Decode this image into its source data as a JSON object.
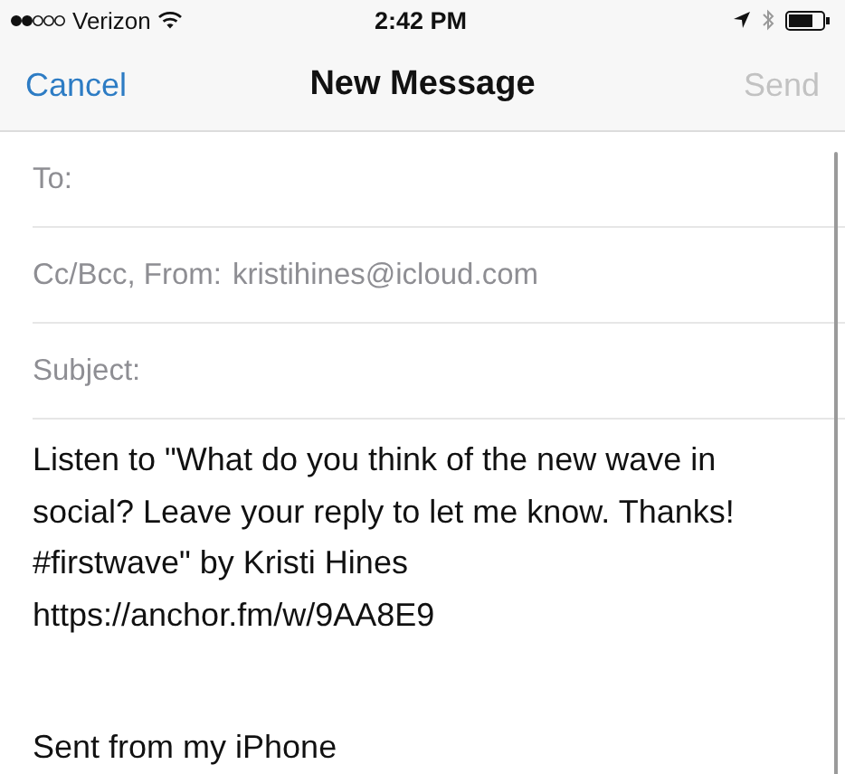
{
  "status_bar": {
    "carrier": "Verizon",
    "time": "2:42 PM"
  },
  "nav_bar": {
    "cancel": {
      "label": "Cancel",
      "disabled": false
    },
    "title": "New Message",
    "send": {
      "label": "Send",
      "disabled": true
    }
  },
  "fields": [
    {
      "label": "To:"
    },
    {
      "label": "Cc/Bcc, From:",
      "value": "kristihines@icloud.com"
    },
    {
      "label": "Subject:"
    }
  ],
  "body": {
    "paragraphs": [
      {
        "lines": [
          "Listen to \"What do you think of the new wave in",
          "social? Leave your reply to let me know. Thanks!",
          "#firstwave\" by Kristi Hines",
          "https://anchor.fm/w/9AA8E9"
        ]
      },
      {
        "lines": [
          "Sent from my iPhone"
        ]
      }
    ]
  }
}
